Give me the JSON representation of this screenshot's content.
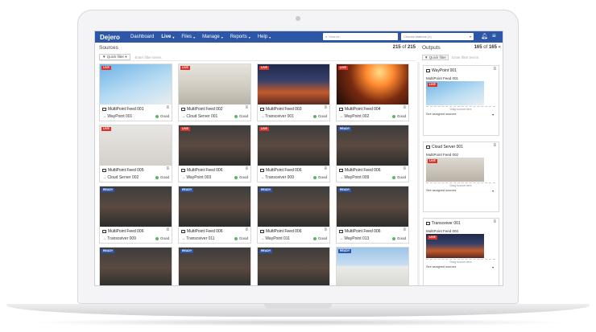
{
  "nav": {
    "logo": "Dejero",
    "items": [
      {
        "label": "Dashboard",
        "caret": false,
        "active": false
      },
      {
        "label": "Live",
        "caret": true,
        "active": true
      },
      {
        "label": "Files",
        "caret": true,
        "active": false
      },
      {
        "label": "Manage",
        "caret": true,
        "active": false
      },
      {
        "label": "Reports",
        "caret": true,
        "active": false
      },
      {
        "label": "Help",
        "caret": true,
        "active": false
      }
    ],
    "search_placeholder": "Search...",
    "choose_stations": "Choose stations (1)"
  },
  "sources": {
    "title": "Sources",
    "count_current": "215",
    "count_of": "of",
    "count_total": "215",
    "quick_filter": "Quick filter",
    "filter_placeholder": "Enter filter terms",
    "cards": [
      {
        "badge": "LIVE",
        "scene": "sc-podium",
        "name": "MultiPoint Feed 001",
        "dest": "→ WayPoint 001",
        "status": "Good"
      },
      {
        "badge": "LIVE",
        "scene": "sc-bikes",
        "name": "MultiPoint Feed 002",
        "dest": "→ Cloud Server 001",
        "status": "Good"
      },
      {
        "badge": "LIVE",
        "scene": "sc-fire",
        "name": "MultiPoint Feed 003",
        "dest": "→ Transceiver 001",
        "status": "Good"
      },
      {
        "badge": "LIVE",
        "scene": "sc-concert",
        "name": "MultiPoint Feed 004",
        "dest": "→ WayPoint 002",
        "status": "Good"
      },
      {
        "badge": "LIVE",
        "scene": "sc-interview",
        "name": "MultiPoint Feed 005",
        "dest": "→ Cloud Server 002",
        "status": "Good"
      },
      {
        "badge": "LIVE",
        "scene": "sc-press",
        "name": "MultiPoint Feed 006",
        "dest": "→ WayPoint 003",
        "status": "Good"
      },
      {
        "badge": "LIVE",
        "scene": "sc-press",
        "name": "MultiPoint Feed 006",
        "dest": "→ Transceiver 009",
        "status": "Good"
      },
      {
        "badge": "READY",
        "scene": "sc-press",
        "name": "MultiPoint Feed 006",
        "dest": "→ WayPoint 009",
        "status": "Good"
      },
      {
        "badge": "READY",
        "scene": "sc-press",
        "name": "MultiPoint Feed 006",
        "dest": "→ Transceiver 009",
        "status": "Good"
      },
      {
        "badge": "READY",
        "scene": "sc-press",
        "name": "MultiPoint Feed 006",
        "dest": "→ Transceiver 011",
        "status": "Good"
      },
      {
        "badge": "READY",
        "scene": "sc-press",
        "name": "MultiPoint Feed 006",
        "dest": "→ WayPoint 011",
        "status": "Good"
      },
      {
        "badge": "READY",
        "scene": "sc-press",
        "name": "MultiPoint Feed 006",
        "dest": "→ WayPoint 013",
        "status": "Good"
      },
      {
        "badge": "READY",
        "scene": "sc-press",
        "name": "",
        "dest": "",
        "status": ""
      },
      {
        "badge": "READY",
        "scene": "sc-press",
        "name": "",
        "dest": "",
        "status": ""
      },
      {
        "badge": "READY",
        "scene": "sc-press",
        "name": "",
        "dest": "",
        "status": ""
      },
      {
        "badge": "READY",
        "scene": "sc-building",
        "name": "",
        "dest": "",
        "status": ""
      }
    ]
  },
  "outputs": {
    "title": "Outputs",
    "count_current": "165",
    "count_of": "of",
    "count_total": "165",
    "quick_filter": "Quick filter",
    "filter_placeholder": "Enter filter terms",
    "cards": [
      {
        "title": "WayPoint 001",
        "source": "MultiPoint Feed 001",
        "badge": "LIVE",
        "scene": "sc-podium",
        "drag": "Drag source here",
        "see": "See assigned sources"
      },
      {
        "title": "Cloud Server 001",
        "source": "MultiPoint Feed 002",
        "badge": "LIVE",
        "scene": "sc-soldiers",
        "drag": "Drag source here",
        "see": "See assigned sources"
      },
      {
        "title": "Transceiver 001",
        "source": "MultiPoint Feed 003",
        "badge": "LIVE",
        "scene": "sc-fire",
        "drag": "Drag source here",
        "see": "See assigned sources"
      }
    ]
  }
}
